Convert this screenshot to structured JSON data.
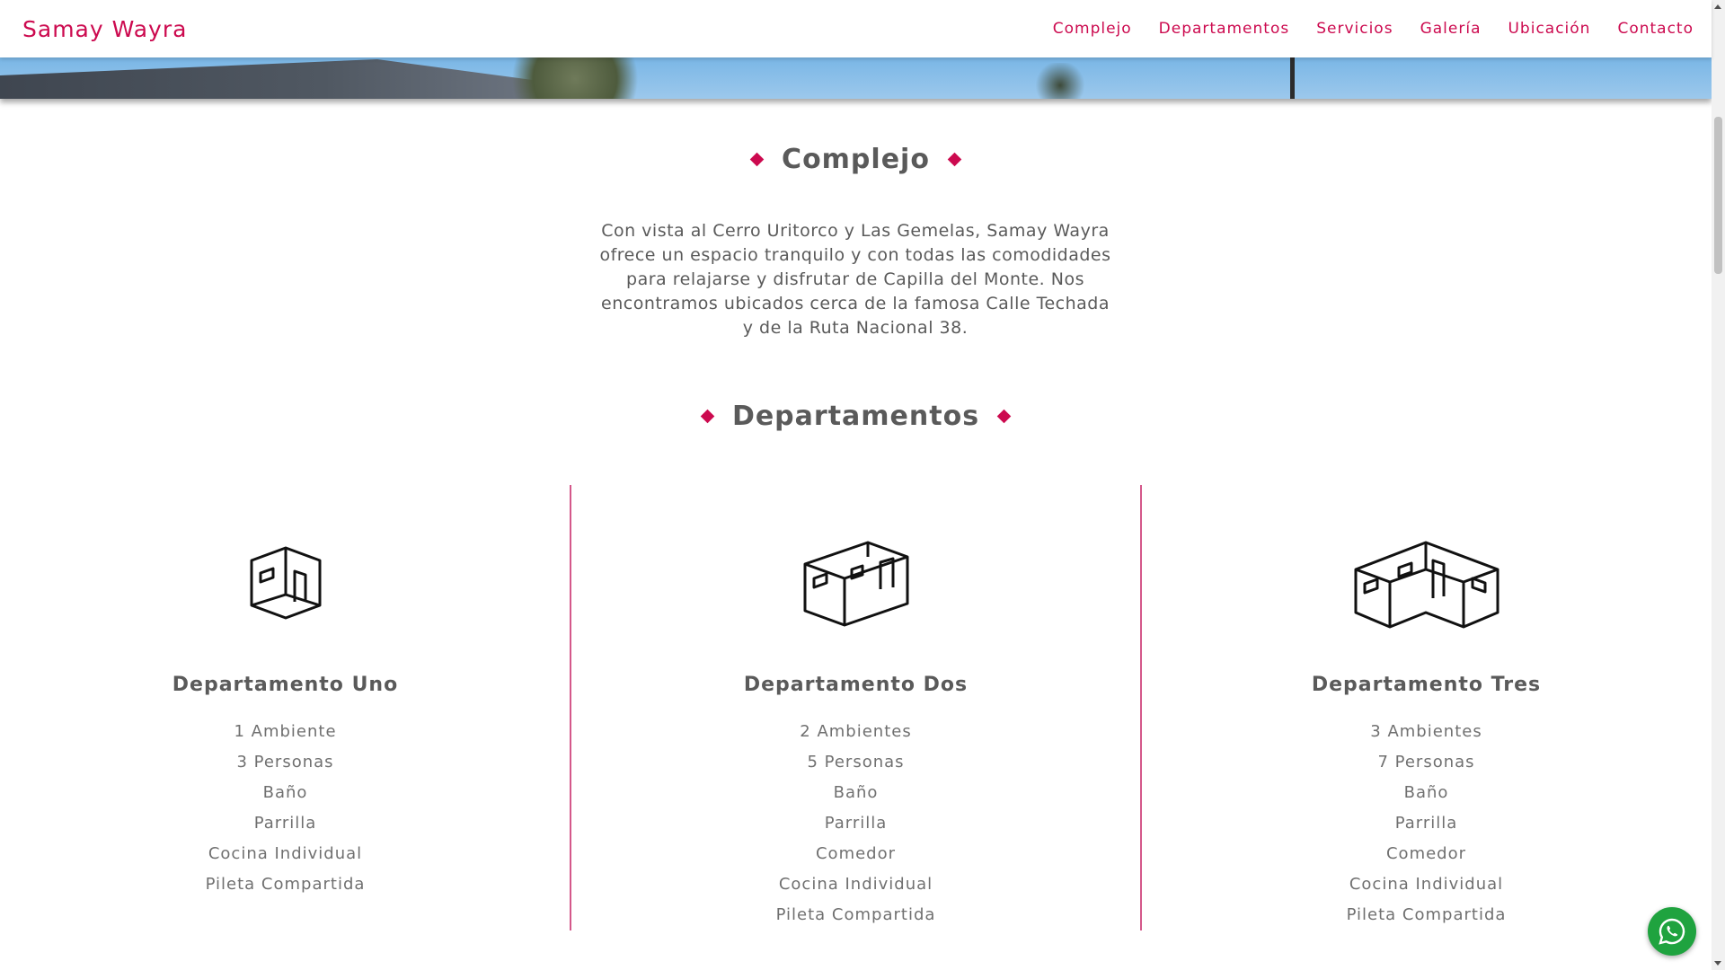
{
  "brand": "Samay Wayra",
  "nav": [
    "Complejo",
    "Departamentos",
    "Servicios",
    "Galería",
    "Ubicación",
    "Contacto"
  ],
  "complejo": {
    "title": "Complejo",
    "text": "Con vista al Cerro Uritorco y Las Gemelas, Samay Wayra ofrece un espacio tranquilo y con todas las comodidades para relajarse y disfrutar de Capilla del Monte. Nos encontramos ubicados cerca de la famosa Calle Techada y de la Ruta Nacional 38."
  },
  "departamentos": {
    "title": "Departamentos",
    "items": [
      {
        "name": "Departamento Uno",
        "icon": "building-small-icon",
        "features": [
          "1 Ambiente",
          "3 Personas",
          "Baño",
          "Parrilla",
          "Cocina Individual",
          "Pileta Compartida"
        ]
      },
      {
        "name": "Departamento Dos",
        "icon": "building-medium-icon",
        "features": [
          "2 Ambientes",
          "5 Personas",
          "Baño",
          "Parrilla",
          "Comedor",
          "Cocina Individual",
          "Pileta Compartida"
        ]
      },
      {
        "name": "Departamento Tres",
        "icon": "building-large-icon",
        "features": [
          "3 Ambientes",
          "7 Personas",
          "Baño",
          "Parrilla",
          "Comedor",
          "Cocina Individual",
          "Pileta Compartida"
        ]
      }
    ]
  },
  "colors": {
    "accent": "#cc0a4f",
    "divider": "#d4588a",
    "whatsapp": "#1fa33f",
    "text": "#5a5a5a"
  },
  "whatsapp_icon": "whatsapp-icon"
}
